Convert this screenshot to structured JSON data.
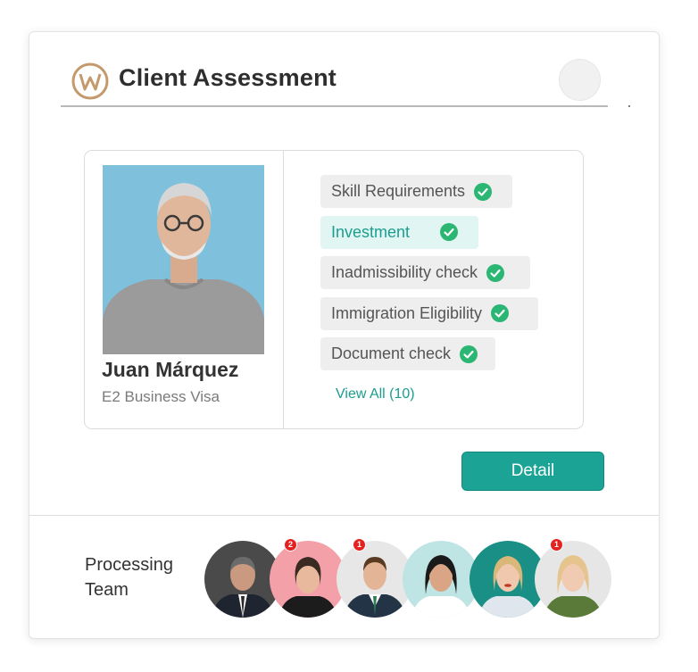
{
  "header": {
    "title": "Client Assessment",
    "logo_icon": "w-logo-icon"
  },
  "client": {
    "name": "Juan Márquez",
    "visa": "E2 Business Visa",
    "checks": [
      {
        "label": "Skill Requirements",
        "status": "complete",
        "active": false
      },
      {
        "label": "Investment",
        "status": "complete",
        "active": true
      },
      {
        "label": "Inadmissibility check",
        "status": "complete",
        "active": false
      },
      {
        "label": "Immigration Eligibility",
        "status": "complete",
        "active": false
      },
      {
        "label": "Document check",
        "status": "complete",
        "active": false
      }
    ],
    "view_all": "View All (10)"
  },
  "actions": {
    "detail": "Detail"
  },
  "team": {
    "label": "Processing Team",
    "members": [
      {
        "badge": ""
      },
      {
        "badge": "2"
      },
      {
        "badge": "1"
      },
      {
        "badge": ""
      },
      {
        "badge": ""
      },
      {
        "badge": "1"
      }
    ]
  },
  "colors": {
    "accent": "#1ba395",
    "check": "#2bb673",
    "badge": "#e52222",
    "logo": "#c49a6c"
  }
}
